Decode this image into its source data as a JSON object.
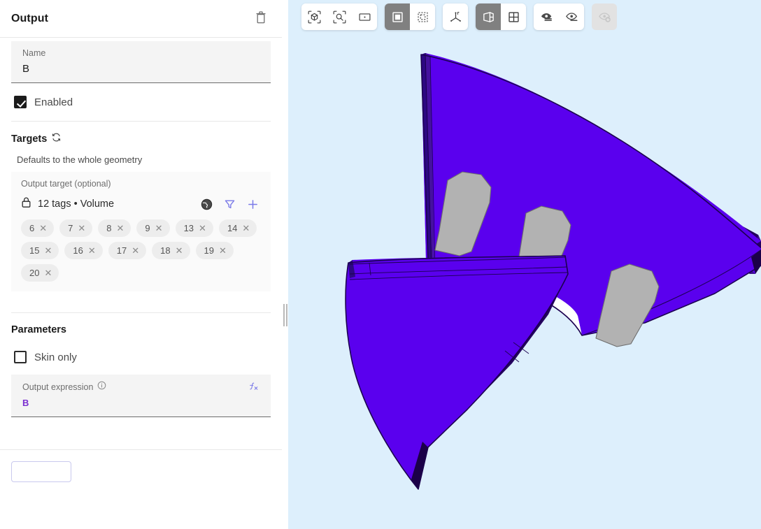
{
  "panel": {
    "title": "Output",
    "delete_icon": "trash-icon",
    "name_field": {
      "label": "Name",
      "value": "B"
    },
    "enabled": {
      "label": "Enabled",
      "checked": true
    },
    "targets": {
      "title": "Targets",
      "refresh_icon": "refresh-icon",
      "subtitle": "Defaults to the whole geometry",
      "card_label": "Output target (optional)",
      "lock_icon": "lock-icon",
      "summary": "12 tags • Volume",
      "actions": [
        {
          "name": "globe-icon",
          "glyph": "globe"
        },
        {
          "name": "filter-icon",
          "glyph": "filter"
        },
        {
          "name": "add-icon",
          "glyph": "plus"
        }
      ],
      "tags": [
        "6",
        "7",
        "8",
        "9",
        "13",
        "14",
        "15",
        "16",
        "17",
        "18",
        "19",
        "20"
      ],
      "remove_glyph": "✕"
    },
    "parameters": {
      "title": "Parameters",
      "skin_only": {
        "label": "Skin only",
        "checked": false
      },
      "output_expression": {
        "label": "Output expression",
        "info_icon": "info-icon",
        "fx_icon": "fx-icon",
        "value": "B"
      }
    }
  },
  "viewport": {
    "background_color": "#ddeffc",
    "toolbar": [
      {
        "group": "view-fit-group",
        "buttons": [
          {
            "name": "fit-to-object-button",
            "icon": "cube-frame-icon",
            "state": "default"
          },
          {
            "name": "zoom-to-selection-button",
            "icon": "magnifier-frame-icon",
            "state": "default"
          },
          {
            "name": "fit-to-screen-button",
            "icon": "rectangle-dot-icon",
            "state": "default"
          }
        ]
      },
      {
        "group": "selection-mode-group",
        "buttons": [
          {
            "name": "solid-select-button",
            "icon": "filled-square-icon",
            "state": "active"
          },
          {
            "name": "box-select-button",
            "icon": "dashed-square-icon",
            "state": "default"
          }
        ]
      },
      {
        "group": "axes-group",
        "buttons": [
          {
            "name": "show-axes-button",
            "icon": "axes-triad-icon",
            "state": "default"
          }
        ]
      },
      {
        "group": "display-mode-group",
        "buttons": [
          {
            "name": "shaded-view-button",
            "icon": "split-panel-icon",
            "state": "active"
          },
          {
            "name": "grid-view-button",
            "icon": "grid-four-icon",
            "state": "default"
          }
        ]
      },
      {
        "group": "visibility-group",
        "buttons": [
          {
            "name": "hide-selected-button",
            "icon": "eye-minus-filled-icon",
            "state": "default"
          },
          {
            "name": "isolate-selected-button",
            "icon": "eye-minus-outline-icon",
            "state": "default"
          }
        ]
      },
      {
        "group": "reset-visibility-group",
        "buttons": [
          {
            "name": "reset-visibility-button",
            "icon": "eye-refresh-icon",
            "state": "disabled"
          }
        ]
      }
    ],
    "model": {
      "name": "motor-stator-sector-3d-model",
      "body_color": "#5a00ee",
      "edge_color": "#1a0055",
      "magnet_color": "#b0b0b0"
    }
  }
}
